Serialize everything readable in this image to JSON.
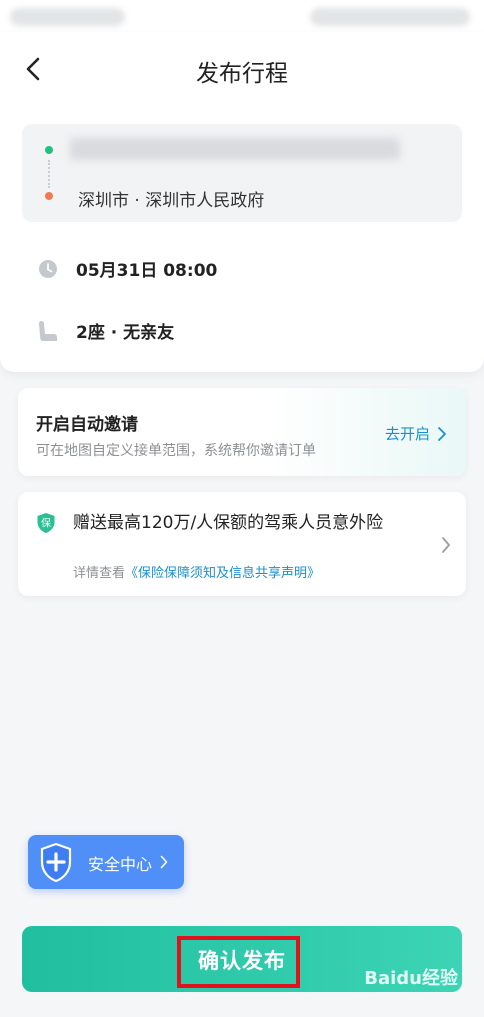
{
  "header": {
    "title": "发布行程"
  },
  "route": {
    "end": "深圳市 · 深圳市人民政府"
  },
  "trip": {
    "time": "05月31日 08:00",
    "seats": "2座 · 无亲友"
  },
  "invite": {
    "title": "开启自动邀请",
    "subtitle": "可在地图自定义接单范围，系统帮你邀请订单",
    "action": "去开启"
  },
  "insurance": {
    "title": "赠送最高120万/人保额的驾乘人员意外险",
    "detail_prefix": "详情查看",
    "detail_link": "《保险保障须知及信息共享声明》",
    "badge": "保"
  },
  "safety": {
    "label": "安全中心"
  },
  "confirm": {
    "label": "确认发布"
  },
  "watermark": {
    "text": "Baidu经验"
  },
  "colors": {
    "accent": "#20bfa0",
    "link": "#1a8fd0",
    "safety": "#4f8ff7",
    "start_dot": "#23c07f",
    "end_dot": "#f07b52",
    "highlight": "#e0121b"
  }
}
